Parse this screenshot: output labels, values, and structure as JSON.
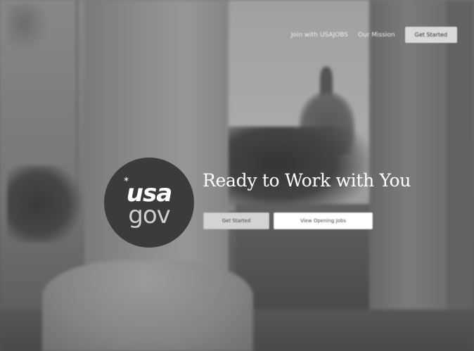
{
  "nav": {
    "link1": "Join with USAJOBS",
    "link2": "Our Mission",
    "button": "Get Started"
  },
  "logo": {
    "top": "usa",
    "bottom": "gov",
    "star": "*"
  },
  "hero": {
    "title": "Ready to Work with You",
    "primary_button": "Get Started",
    "secondary_button": "View Opening Jobs"
  }
}
